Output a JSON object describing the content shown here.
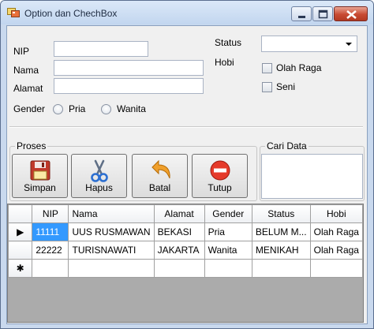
{
  "window": {
    "title": "Option dan ChechBox"
  },
  "form": {
    "nip_label": "NIP",
    "nama_label": "Nama",
    "alamat_label": "Alamat",
    "gender_label": "Gender",
    "gender_options": [
      "Pria",
      "Wanita"
    ],
    "status_label": "Status",
    "status_value": "",
    "hobi_label": "Hobi",
    "hobi_options": [
      "Olah Raga",
      "Seni"
    ],
    "nip_value": "",
    "nama_value": "",
    "alamat_value": ""
  },
  "proses": {
    "title": "Proses",
    "buttons": [
      {
        "label": "Simpan",
        "icon": "floppy-disk-icon"
      },
      {
        "label": "Hapus",
        "icon": "scissors-icon"
      },
      {
        "label": "Batal",
        "icon": "undo-arrow-icon"
      },
      {
        "label": "Tutup",
        "icon": "stop-icon"
      }
    ]
  },
  "cari": {
    "title": "Cari Data",
    "value": ""
  },
  "grid": {
    "columns": [
      "NIP",
      "Nama",
      "Alamat",
      "Gender",
      "Status",
      "Hobi"
    ],
    "rows": [
      [
        "11111",
        "UUS RUSMAWAN",
        "BEKASI",
        "Pria",
        "BELUM M...",
        "Olah Raga"
      ],
      [
        "22222",
        "TURISNAWATI",
        "JAKARTA",
        "Wanita",
        "MENIKAH",
        "Olah Raga"
      ]
    ],
    "current_row_marker": "▶",
    "new_row_marker": "✱"
  },
  "colors": {
    "title_bar": "#c9d9ee",
    "selection": "#3399ff",
    "close_button": "#c84a32"
  }
}
